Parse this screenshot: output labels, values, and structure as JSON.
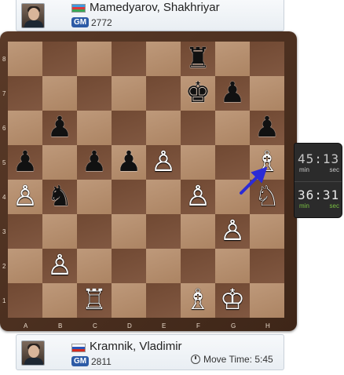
{
  "top_player": {
    "name": "Mamedyarov, Shakhriyar",
    "title": "GM",
    "rating": "2772",
    "flag": "azerbaijan-flag"
  },
  "bottom_player": {
    "name": "Kramnik, Vladimir",
    "title": "GM",
    "rating": "2811",
    "flag": "russia-flag",
    "move_time": "Move Time: 5:45"
  },
  "clocks": {
    "top": {
      "time": "45:13",
      "min_label": "min",
      "sec_label": "sec"
    },
    "bottom": {
      "time": "36:31",
      "min_label": "min",
      "sec_label": "sec"
    }
  },
  "board": {
    "ranks": [
      "8",
      "7",
      "6",
      "5",
      "4",
      "3",
      "2",
      "1"
    ],
    "files": [
      "A",
      "B",
      "C",
      "D",
      "E",
      "F",
      "G",
      "H"
    ],
    "pieces": [
      {
        "square": "f8",
        "piece": "rook",
        "color": "black",
        "glyph": "♜"
      },
      {
        "square": "f7",
        "piece": "king",
        "color": "black",
        "glyph": "♚"
      },
      {
        "square": "g7",
        "piece": "pawn",
        "color": "black",
        "glyph": "♟"
      },
      {
        "square": "b6",
        "piece": "pawn",
        "color": "black",
        "glyph": "♟"
      },
      {
        "square": "h6",
        "piece": "pawn",
        "color": "black",
        "glyph": "♟"
      },
      {
        "square": "a5",
        "piece": "pawn",
        "color": "black",
        "glyph": "♟"
      },
      {
        "square": "c5",
        "piece": "pawn",
        "color": "black",
        "glyph": "♟"
      },
      {
        "square": "d5",
        "piece": "pawn",
        "color": "black",
        "glyph": "♟"
      },
      {
        "square": "e5",
        "piece": "pawn",
        "color": "white",
        "glyph": "♙"
      },
      {
        "square": "h5",
        "piece": "bishop",
        "color": "white",
        "glyph": "♗"
      },
      {
        "square": "a4",
        "piece": "pawn",
        "color": "white",
        "glyph": "♙"
      },
      {
        "square": "b4",
        "piece": "knight",
        "color": "black",
        "glyph": "♞"
      },
      {
        "square": "f4",
        "piece": "pawn",
        "color": "white",
        "glyph": "♙"
      },
      {
        "square": "h4",
        "piece": "knight",
        "color": "white",
        "glyph": "♘"
      },
      {
        "square": "g3",
        "piece": "pawn",
        "color": "white",
        "glyph": "♙"
      },
      {
        "square": "b2",
        "piece": "pawn",
        "color": "white",
        "glyph": "♙"
      },
      {
        "square": "c1",
        "piece": "rook",
        "color": "white",
        "glyph": "♖"
      },
      {
        "square": "f1",
        "piece": "bishop",
        "color": "white",
        "glyph": "♗"
      },
      {
        "square": "g1",
        "piece": "king",
        "color": "white",
        "glyph": "♔"
      }
    ],
    "arrow": {
      "from": "g4",
      "to": "h5",
      "color": "#2b2bd6"
    }
  }
}
